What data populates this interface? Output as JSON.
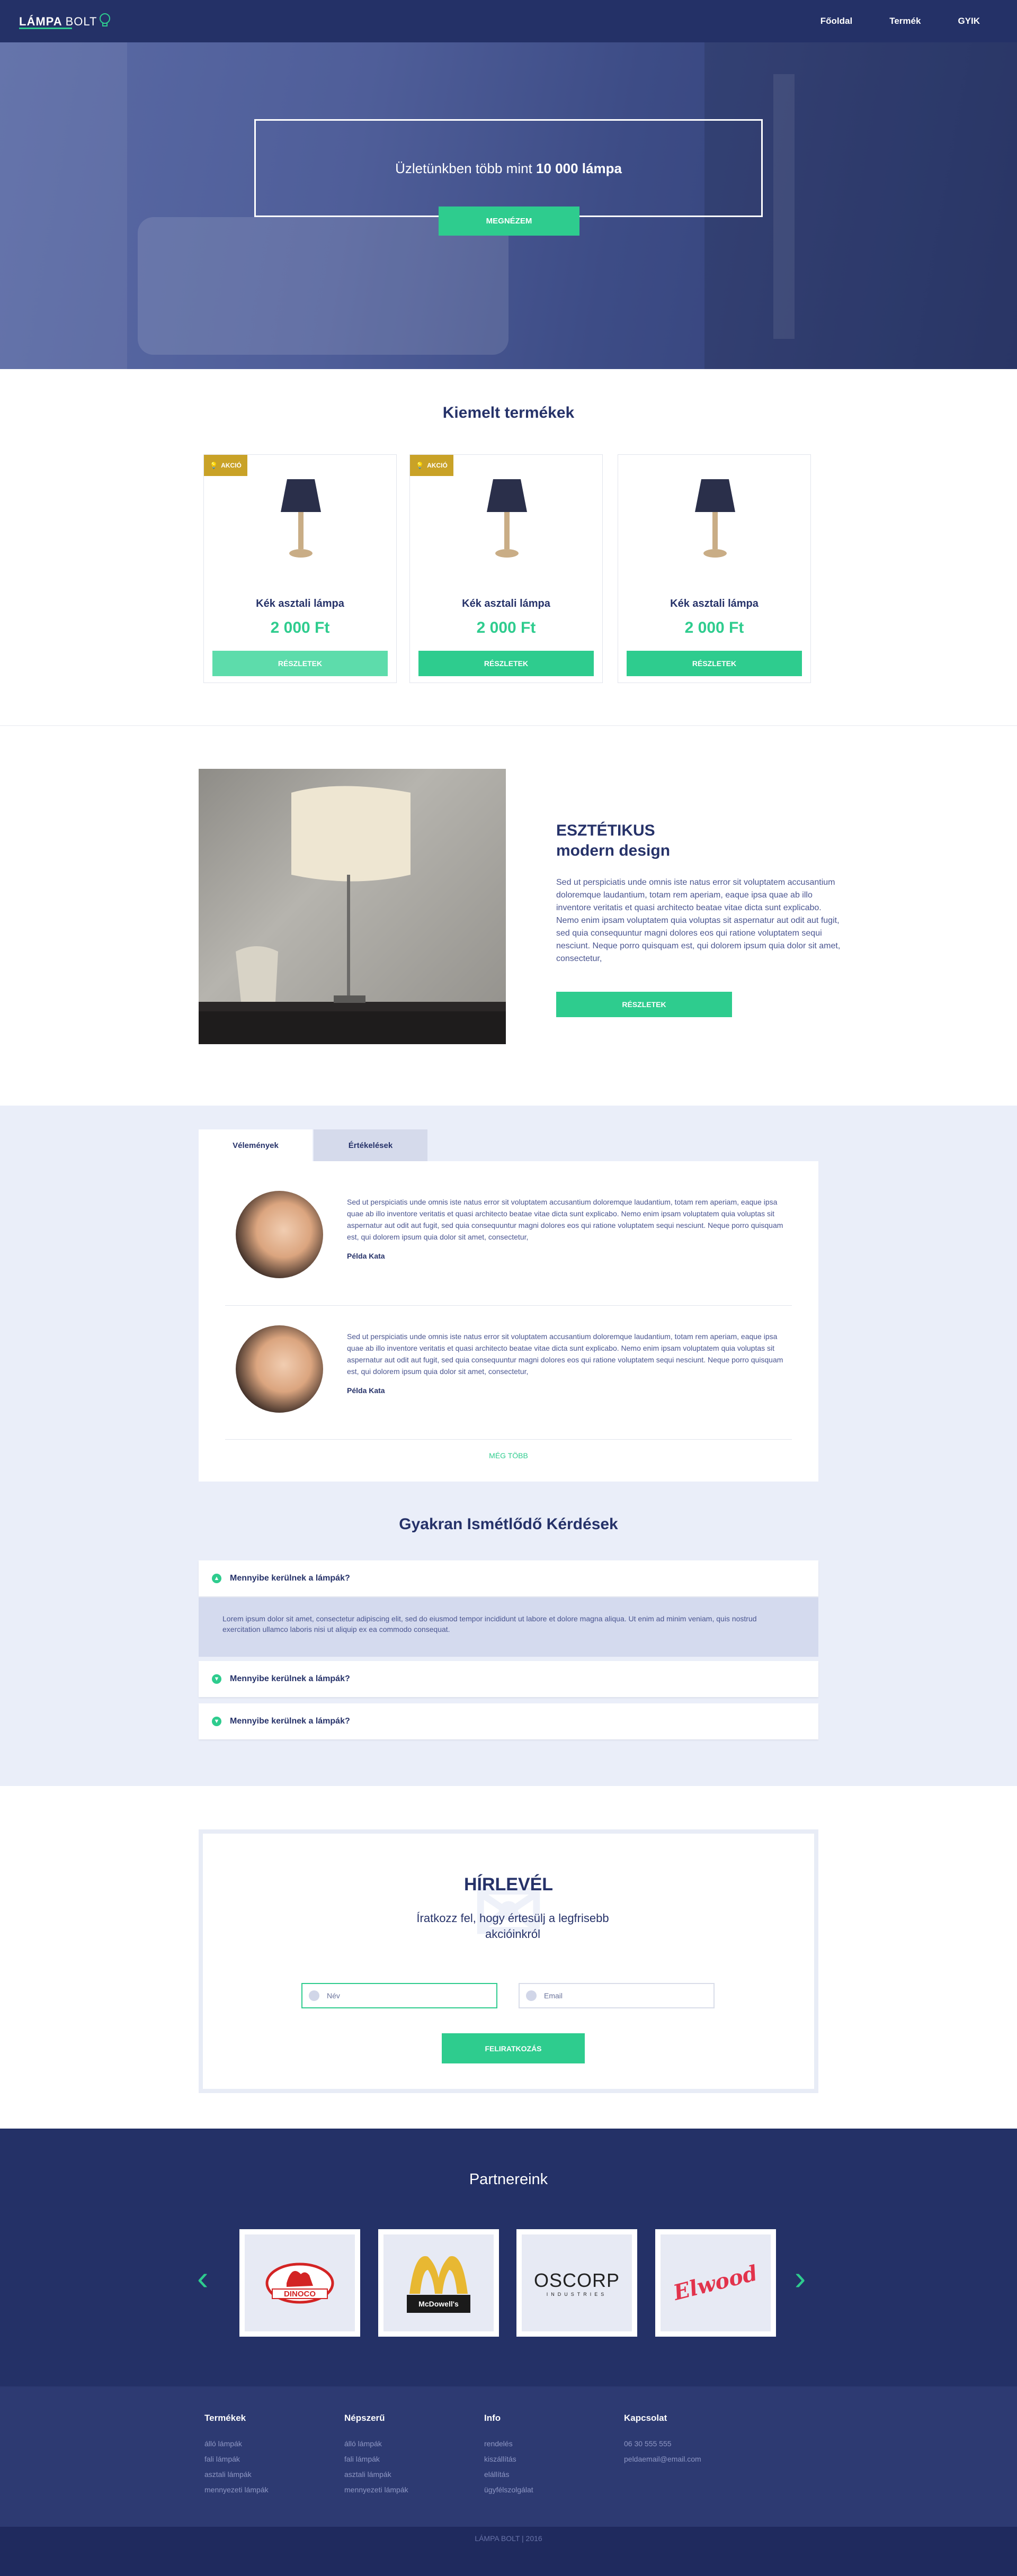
{
  "header": {
    "logo_bold": "LÁMPA",
    "logo_light": "BOLT",
    "nav": [
      "Főoldal",
      "Termék",
      "GYIK"
    ]
  },
  "hero": {
    "text_prefix": "Üzletünkben több mint",
    "text_bold": "10 000 lámpa",
    "button": "MEGNÉZEM"
  },
  "featured": {
    "title": "Kiemelt termékek",
    "badge": "AKCIÓ",
    "products": [
      {
        "name": "Kék asztali lámpa",
        "price": "2 000 Ft",
        "button": "RÉSZLETEK",
        "badge": true
      },
      {
        "name": "Kék asztali lámpa",
        "price": "2 000 Ft",
        "button": "RÉSZLETEK",
        "badge": true
      },
      {
        "name": "Kék asztali lámpa",
        "price": "2 000 Ft",
        "button": "RÉSZLETEK",
        "badge": false
      }
    ]
  },
  "design": {
    "title_line1": "ESZTÉTIKUS",
    "title_line2": "modern design",
    "text": "Sed ut perspiciatis unde omnis iste natus error sit voluptatem accusantium doloremque laudantium, totam rem aperiam, eaque ipsa quae ab illo inventore veritatis et quasi architecto beatae vitae dicta sunt explicabo. Nemo enim ipsam voluptatem quia voluptas sit aspernatur aut odit aut fugit, sed quia consequuntur magni dolores eos qui ratione voluptatem sequi nesciunt. Neque porro quisquam est, qui dolorem ipsum quia dolor sit amet, consectetur,",
    "button": "RÉSZLETEK"
  },
  "reviews": {
    "tabs": [
      "Vélemények",
      "Értékelések"
    ],
    "items": [
      {
        "text": "Sed ut perspiciatis unde omnis iste natus error sit voluptatem accusantium doloremque laudantium, totam rem aperiam, eaque ipsa quae ab illo inventore veritatis et quasi architecto beatae vitae dicta sunt explicabo. Nemo enim ipsam voluptatem quia voluptas sit aspernatur aut odit aut fugit, sed quia consequuntur magni dolores eos qui ratione voluptatem sequi nesciunt. Neque porro quisquam est, qui dolorem ipsum quia dolor sit amet, consectetur,",
        "author": "Példa Kata"
      },
      {
        "text": "Sed ut perspiciatis unde omnis iste natus error sit voluptatem accusantium doloremque laudantium, totam rem aperiam, eaque ipsa quae ab illo inventore veritatis et quasi architecto beatae vitae dicta sunt explicabo. Nemo enim ipsam voluptatem quia voluptas sit aspernatur aut odit aut fugit, sed quia consequuntur magni dolores eos qui ratione voluptatem sequi nesciunt. Neque porro quisquam est, qui dolorem ipsum quia dolor sit amet, consectetur,",
        "author": "Példa Kata"
      }
    ],
    "more": "MÉG TÖBB"
  },
  "faq": {
    "title": "Gyakran Ismétlődő Kérdések",
    "questions": [
      "Mennyibe kerülnek a lámpák?",
      "Mennyibe kerülnek a lámpák?",
      "Mennyibe kerülnek a lámpák?"
    ],
    "answer": "Lorem ipsum dolor sit amet, consectetur adipiscing elit, sed do eiusmod tempor incididunt ut labore et dolore magna aliqua. Ut enim ad minim veniam, quis nostrud exercitation ullamco laboris nisi ut aliquip ex ea commodo consequat."
  },
  "newsletter": {
    "title": "HÍRLEVÉL",
    "subtitle": "Íratkozz fel, hogy értesülj a legfrisebb akcióinkról",
    "name_placeholder": "Név",
    "email_placeholder": "Email",
    "button": "FELIRATKOZÁS"
  },
  "partners": {
    "title": "Partnereink",
    "logos": [
      "DINOCO",
      "McDowell's",
      "OSCORP",
      "Elwood"
    ],
    "oscorp_sub": "INDUSTRIES"
  },
  "footer": {
    "columns": [
      {
        "title": "Termékek",
        "items": [
          "álló lámpák",
          "fali lámpák",
          "asztali lámpák",
          "mennyezeti lámpák"
        ]
      },
      {
        "title": "Népszerű",
        "items": [
          "álló lámpák",
          "fali lámpák",
          "asztali lámpák",
          "mennyezeti lámpák"
        ]
      },
      {
        "title": "Info",
        "items": [
          "rendelés",
          "kiszállítás",
          "elállítás",
          "ügyfélszolgálat"
        ]
      },
      {
        "title": "Kapcsolat",
        "items": [
          "06 30 555 555",
          "peldaemail@email.com"
        ]
      }
    ],
    "copyright": "LÁMPA BOLT  |  2016"
  },
  "colors": {
    "navy": "#243167",
    "green": "#2ecc8e",
    "gold": "#c9a227",
    "light_blue": "#eaeef9"
  }
}
